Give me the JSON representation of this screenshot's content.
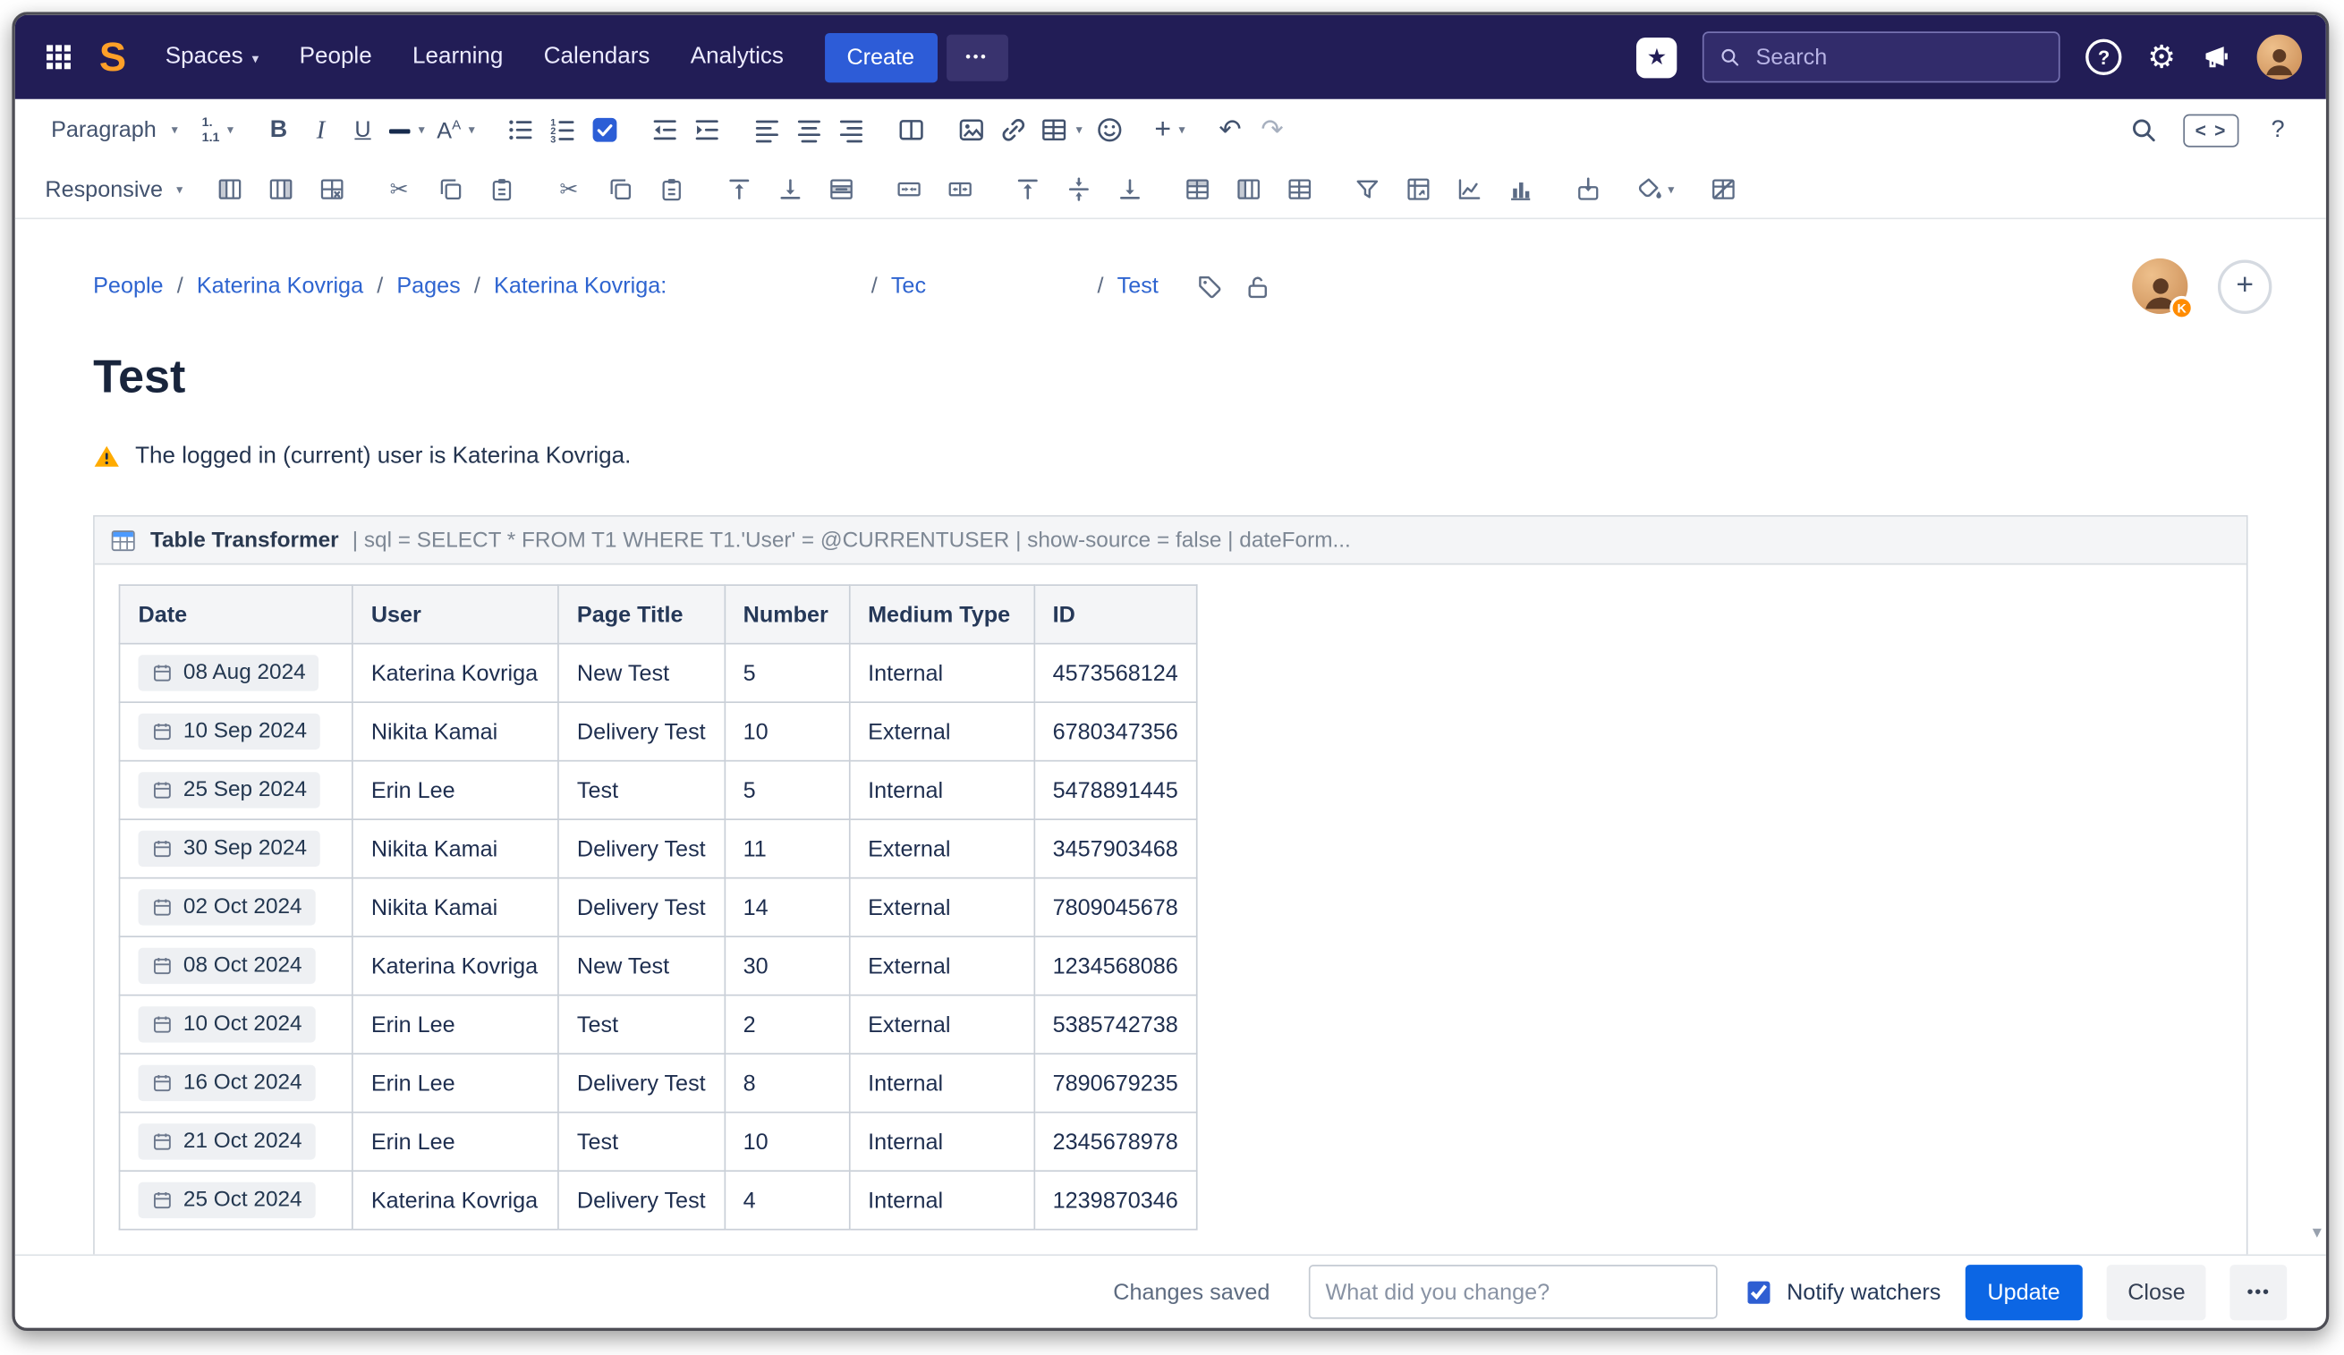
{
  "glyphs": {
    "chevron": "▾",
    "bold": "B",
    "italic": "I",
    "underline": "U",
    "letter_a": "A",
    "sup_a": "A",
    "plus": "+",
    "undo": "↶",
    "redo": "↷",
    "star": "★",
    "gear": "⚙",
    "question": "?"
  },
  "navbar": {
    "brand_letter": "S",
    "items": [
      {
        "label": "Spaces",
        "chevron": true
      },
      {
        "label": "People"
      },
      {
        "label": "Learning"
      },
      {
        "label": "Calendars"
      },
      {
        "label": "Analytics"
      }
    ],
    "create_label": "Create",
    "more_label": "•••",
    "search_placeholder": "Search"
  },
  "toolbar": {
    "paragraph_label": "Paragraph",
    "list_style_top": "1.",
    "list_style_bottom": "1.1",
    "source_label": "< >",
    "help": "?"
  },
  "table_toolbar": {
    "responsive_label": "Responsive",
    "groups": [
      [
        {
          "name": "insert-column-left-icon",
          "sym": "col-left"
        },
        {
          "name": "insert-column-right-icon",
          "sym": "col-right"
        },
        {
          "name": "delete-column-icon",
          "sym": "cell-x"
        }
      ],
      [
        {
          "name": "cut-row-icon",
          "glyph": "✂"
        },
        {
          "name": "copy-row-icon",
          "sym": "copy"
        },
        {
          "name": "paste-row-icon",
          "sym": "paste"
        }
      ],
      [
        {
          "name": "cut-column-icon",
          "glyph": "✂"
        },
        {
          "name": "copy-column-icon",
          "sym": "copy"
        },
        {
          "name": "paste-column-icon",
          "sym": "paste"
        }
      ],
      [
        {
          "name": "insert-row-above-icon",
          "sym": "bar-up"
        },
        {
          "name": "insert-row-below-icon",
          "sym": "bar-down"
        },
        {
          "name": "delete-row-icon",
          "sym": "row-del"
        }
      ],
      [
        {
          "name": "merge-cells-icon",
          "sym": "merge"
        },
        {
          "name": "split-cells-icon",
          "sym": "split"
        }
      ],
      [
        {
          "name": "align-cells-top-icon",
          "sym": "bar-up"
        },
        {
          "name": "align-cells-middle-icon",
          "sym": "bar-mid"
        },
        {
          "name": "align-cells-bottom-icon",
          "sym": "bar-down"
        }
      ],
      [
        {
          "name": "header-row-icon",
          "sym": "row-top"
        },
        {
          "name": "header-column-icon",
          "sym": "col-left"
        },
        {
          "name": "full-grid-icon",
          "sym": "table"
        }
      ],
      [
        {
          "name": "filter-table-icon",
          "sym": "funnel"
        },
        {
          "name": "pivot-table-icon",
          "sym": "pivot"
        },
        {
          "name": "chart-from-table-icon",
          "sym": "chart-line"
        },
        {
          "name": "bar-chart-from-table-icon",
          "sym": "chart-bars"
        }
      ],
      [
        {
          "name": "copy-style-icon",
          "sym": "copy-box"
        }
      ],
      [
        {
          "name": "cell-shading-icon",
          "sym": "bucket",
          "chevron": true
        }
      ],
      [
        {
          "name": "clear-formatting-icon",
          "sym": "no-format"
        }
      ]
    ]
  },
  "breadcrumb": {
    "separator": "/",
    "items": [
      "People",
      "Katerina Kovriga",
      "Pages",
      "Katerina Kovriga:",
      "Tec",
      "Test"
    ]
  },
  "page_header": {
    "avatar_badge": "K"
  },
  "page": {
    "title": "Test",
    "warning": "The logged in (current) user is Katerina Kovriga."
  },
  "macro": {
    "name": "Table Transformer",
    "params": "| sql = SELECT * FROM T1  WHERE T1.'User' = @CURRENTUSER | show-source = false | dateForm..."
  },
  "table": {
    "headers": [
      "Date",
      "User",
      "Page Title",
      "Number",
      "Medium Type",
      "ID"
    ],
    "rows": [
      [
        "08 Aug 2024",
        "Katerina Kovriga",
        "New Test",
        "5",
        "Internal",
        "4573568124"
      ],
      [
        "10 Sep 2024",
        "Nikita Kamai",
        "Delivery Test",
        "10",
        "External",
        "6780347356"
      ],
      [
        "25 Sep 2024",
        "Erin Lee",
        "Test",
        "5",
        "Internal",
        "5478891445"
      ],
      [
        "30 Sep 2024",
        "Nikita Kamai",
        "Delivery Test",
        "11",
        "External",
        "3457903468"
      ],
      [
        "02 Oct 2024",
        "Nikita Kamai",
        "Delivery Test",
        "14",
        "External",
        "7809045678"
      ],
      [
        "08 Oct 2024",
        "Katerina Kovriga",
        "New Test",
        "30",
        "External",
        "1234568086"
      ],
      [
        "10 Oct 2024",
        "Erin Lee",
        "Test",
        "2",
        "External",
        "5385742738"
      ],
      [
        "16 Oct 2024",
        "Erin Lee",
        "Delivery Test",
        "8",
        "Internal",
        "7890679235"
      ],
      [
        "21 Oct 2024",
        "Erin Lee",
        "Test",
        "10",
        "Internal",
        "2345678978"
      ],
      [
        "25 Oct 2024",
        "Katerina Kovriga",
        "Delivery Test",
        "4",
        "Internal",
        "1239870346"
      ]
    ]
  },
  "footer": {
    "status": "Changes saved",
    "comment_placeholder": "What did you change?",
    "notify_label": "Notify watchers",
    "update_label": "Update",
    "close_label": "Close",
    "more_label": "•••"
  },
  "colors": {
    "navbar": "#221d56",
    "accent_blue": "#0c66e4",
    "link": "#2e64d0",
    "warning": "#ffab00",
    "badge": "#ff8b00"
  }
}
